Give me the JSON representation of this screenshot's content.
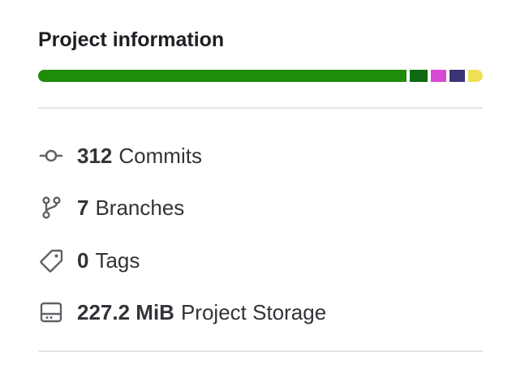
{
  "panel": {
    "title": "Project information"
  },
  "languages": [
    {
      "color": "#1f8c0a",
      "share": 0.853
    },
    {
      "color": "#0f6a12",
      "share": 0.042
    },
    {
      "color": "#d94ad4",
      "share": 0.036
    },
    {
      "color": "#3b3575",
      "share": 0.036
    },
    {
      "color": "#ede055",
      "share": 0.033
    }
  ],
  "stats": {
    "commits": {
      "value": "312",
      "label": "Commits",
      "icon": "commit-icon"
    },
    "branches": {
      "value": "7",
      "label": "Branches",
      "icon": "branch-icon"
    },
    "tags": {
      "value": "0",
      "label": "Tags",
      "icon": "tag-icon"
    },
    "storage": {
      "value": "227.2 MiB",
      "label": "Project Storage",
      "icon": "storage-icon"
    }
  },
  "colors": {
    "text": "#333238",
    "icon": "#626168",
    "divider": "#e4e3e8"
  }
}
